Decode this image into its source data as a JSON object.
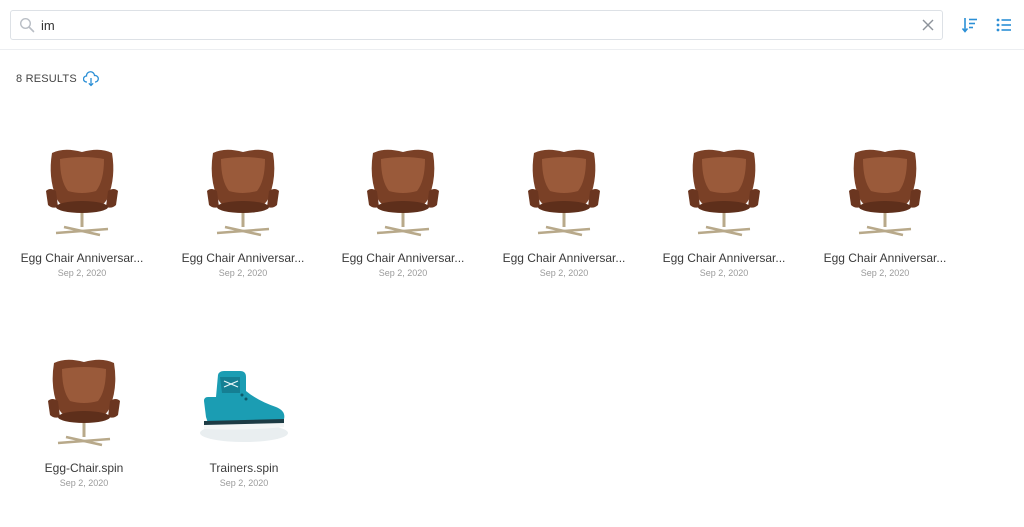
{
  "search": {
    "value": "im",
    "placeholder": ""
  },
  "toolbar": {
    "sort_icon": "sort-icon",
    "list_icon": "list-view-icon",
    "accent": "#2b8fd6"
  },
  "results": {
    "count_label": "8 RESULTS",
    "download_icon": "cloud-download-icon"
  },
  "items": [
    {
      "name": "Egg Chair Anniversar...",
      "date": "Sep 2, 2020",
      "thumb": "egg-chair"
    },
    {
      "name": "Egg Chair Anniversar...",
      "date": "Sep 2, 2020",
      "thumb": "egg-chair"
    },
    {
      "name": "Egg Chair Anniversar...",
      "date": "Sep 2, 2020",
      "thumb": "egg-chair"
    },
    {
      "name": "Egg Chair Anniversar...",
      "date": "Sep 2, 2020",
      "thumb": "egg-chair"
    },
    {
      "name": "Egg Chair Anniversar...",
      "date": "Sep 2, 2020",
      "thumb": "egg-chair"
    },
    {
      "name": "Egg Chair Anniversar...",
      "date": "Sep 2, 2020",
      "thumb": "egg-chair"
    },
    {
      "name": "Egg-Chair.spin",
      "date": "Sep 2, 2020",
      "thumb": "egg-chair"
    },
    {
      "name": "Trainers.spin",
      "date": "Sep 2, 2020",
      "thumb": "trainer-shoe"
    }
  ]
}
